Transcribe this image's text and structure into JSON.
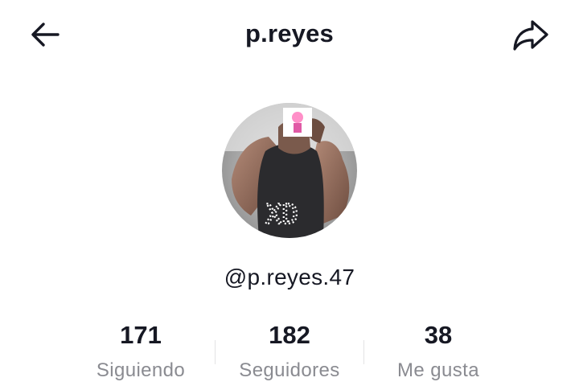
{
  "header": {
    "back_icon": "arrow-left-icon",
    "title": "p.reyes",
    "share_icon": "share-arrow-icon"
  },
  "profile": {
    "avatar_icon": "profile-photo",
    "avatar_overlay_text": "XD",
    "handle": "@p.reyes.47"
  },
  "stats": [
    {
      "value": "171",
      "label": "Siguiendo"
    },
    {
      "value": "182",
      "label": "Seguidores"
    },
    {
      "value": "38",
      "label": "Me gusta"
    }
  ],
  "colors": {
    "text_primary": "#161823",
    "text_secondary": "#8a8b91",
    "divider": "#e3e3e4",
    "background": "#ffffff"
  }
}
